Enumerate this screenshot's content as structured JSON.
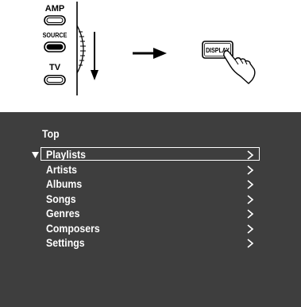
{
  "remote": {
    "buttons": [
      {
        "label": "AMP"
      },
      {
        "label": "SOURCE"
      },
      {
        "label": "TV"
      }
    ],
    "display_button": {
      "label": "DISPLAY"
    }
  },
  "menu": {
    "title": "Top",
    "items": [
      {
        "label": "Playlists",
        "selected": true
      },
      {
        "label": "Artists"
      },
      {
        "label": "Albums"
      },
      {
        "label": "Songs"
      },
      {
        "label": "Genres"
      },
      {
        "label": "Composers"
      },
      {
        "label": "Settings"
      }
    ]
  },
  "colors": {
    "screen_background": "#3e3e3e",
    "menu_text": "#ffffff",
    "illustration_ink": "#000000"
  }
}
